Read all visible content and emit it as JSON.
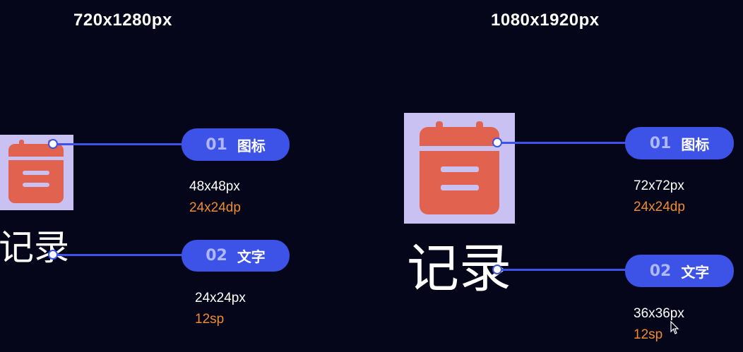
{
  "left_panel": {
    "title": "720x1280px",
    "word": "记录",
    "callouts": [
      {
        "number": "01",
        "label": "图标",
        "size_px": "48x48px",
        "size_unit": "24x24dp"
      },
      {
        "number": "02",
        "label": "文字",
        "size_px": "24x24px",
        "size_unit": "12sp"
      }
    ]
  },
  "right_panel": {
    "title": "1080x1920px",
    "word": "记录",
    "callouts": [
      {
        "number": "01",
        "label": "图标",
        "size_px": "72x72px",
        "size_unit": "24x24dp"
      },
      {
        "number": "02",
        "label": "文字",
        "size_px": "36x36px",
        "size_unit": "12sp"
      }
    ]
  },
  "colors": {
    "background": "#050619",
    "accent": "#3d52e6",
    "icon_bg": "#c8c1f2",
    "icon_fg": "#e0624f",
    "unit_text": "#ee8a35"
  },
  "icon_name": "calendar-icon"
}
